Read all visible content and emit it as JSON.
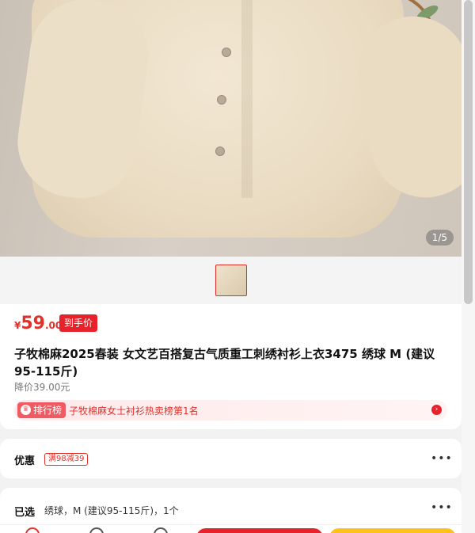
{
  "gallery": {
    "counter_current": "1",
    "counter_total": "/5"
  },
  "price": {
    "currency": "¥",
    "integer": "59",
    "decimal": ".00",
    "tag": "到手价"
  },
  "product": {
    "title": "子牧棉麻2025春装 女文艺百搭复古气质重工刺绣衬衫上衣3475 绣球 M (建议95-115斤)",
    "original_price": "降价39.00元"
  },
  "ranking": {
    "badge": "排行榜",
    "text": "子牧棉麻女士衬衫热卖榜第1名"
  },
  "promo": {
    "label": "优惠",
    "coupon": "满98减39"
  },
  "selection": {
    "label": "已选",
    "value": "绣球，M (建议95-115斤)，1个"
  },
  "colors": {
    "accent": "#e8222a",
    "buy_now": "#ffc21a"
  }
}
